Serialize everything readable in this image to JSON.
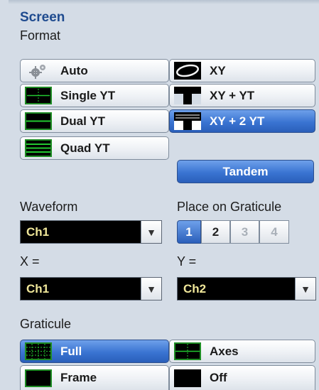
{
  "panel": {
    "title": "Screen"
  },
  "format": {
    "label": "Format",
    "auto": "Auto",
    "xy": "XY",
    "single_yt": "Single YT",
    "xy_yt": "XY + YT",
    "dual_yt": "Dual YT",
    "xy_2yt": "XY + 2 YT",
    "quad_yt": "Quad YT",
    "tandem": "Tandem"
  },
  "waveform": {
    "label": "Waveform",
    "value": "Ch1"
  },
  "place": {
    "label": "Place on Graticule",
    "options": [
      "1",
      "2",
      "3",
      "4"
    ],
    "selected": "1"
  },
  "x": {
    "label": "X =",
    "value": "Ch1"
  },
  "y": {
    "label": "Y =",
    "value": "Ch2"
  },
  "graticule": {
    "label": "Graticule",
    "full": "Full",
    "axes": "Axes",
    "frame": "Frame",
    "off": "Off"
  },
  "colors": {
    "accent": "#3a74d2",
    "title": "#1f4b8f",
    "trace": "#f0e79a",
    "grid": "#1e8c24"
  }
}
